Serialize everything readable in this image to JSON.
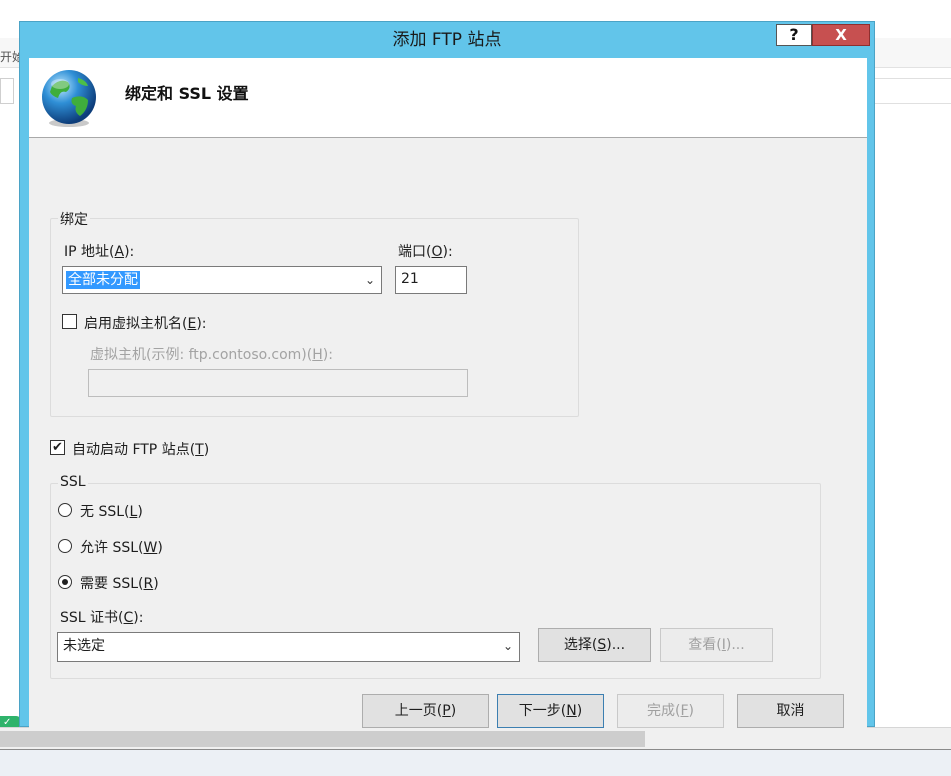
{
  "background": {
    "tab_fragment": "开始",
    "badge_fragment": "✓"
  },
  "dialog": {
    "title": "添加 FTP 站点",
    "help_label": "?",
    "close_label": "X",
    "header_title": "绑定和 SSL 设置",
    "icon": "globe-icon"
  },
  "binding": {
    "group_label": "绑定",
    "ip_label": "IP 地址(",
    "ip_mnemonic": "A",
    "ip_suffix": "):",
    "ip_value": "全部未分配",
    "port_label": "端口(",
    "port_mnemonic": "O",
    "port_suffix": "):",
    "port_value": "21",
    "vhost_enable_label": "启用虚拟主机名(",
    "vhost_enable_mnemonic": "E",
    "vhost_enable_suffix": "):",
    "vhost_enabled": false,
    "vhost_label": "虚拟主机(示例: ftp.contoso.com)(",
    "vhost_mnemonic": "H",
    "vhost_suffix": "):",
    "vhost_value": ""
  },
  "autostart": {
    "label": "自动启动 FTP 站点(",
    "mnemonic": "T",
    "suffix": ")",
    "checked": true
  },
  "ssl": {
    "group_label": "SSL",
    "options": [
      {
        "label": "无 SSL(",
        "mnemonic": "L",
        "suffix": ")",
        "selected": false
      },
      {
        "label": "允许 SSL(",
        "mnemonic": "W",
        "suffix": ")",
        "selected": false
      },
      {
        "label": "需要 SSL(",
        "mnemonic": "R",
        "suffix": ")",
        "selected": true
      }
    ],
    "cert_label": "SSL 证书(",
    "cert_mnemonic": "C",
    "cert_suffix": "):",
    "cert_value": "未选定",
    "select_button": {
      "label": "选择(",
      "mnemonic": "S",
      "suffix": ")..."
    },
    "view_button": {
      "label": "查看(",
      "mnemonic": "I",
      "suffix": ")..."
    }
  },
  "footer": {
    "prev": {
      "label": "上一页(",
      "mnemonic": "P",
      "suffix": ")"
    },
    "next": {
      "label": "下一步(",
      "mnemonic": "N",
      "suffix": ")"
    },
    "finish": {
      "label": "完成(",
      "mnemonic": "F",
      "suffix": ")"
    },
    "cancel": {
      "label": "取消"
    }
  },
  "colors": {
    "title_bar": "#62c5ea",
    "close_button": "#c75050",
    "selection": "#3399ff"
  }
}
